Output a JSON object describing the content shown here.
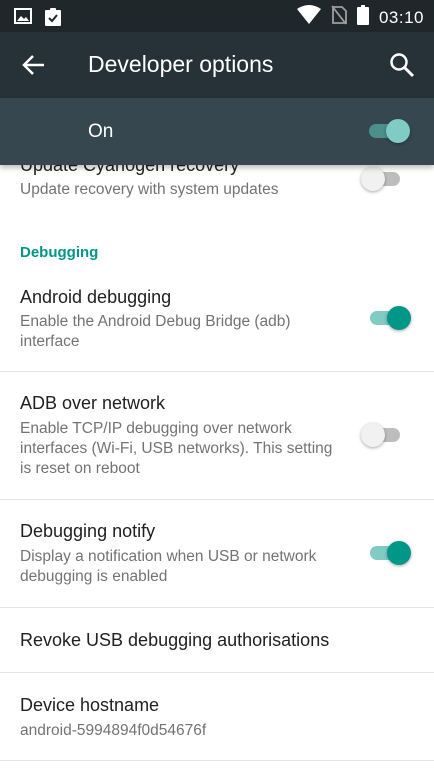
{
  "status_bar": {
    "time": "03:10",
    "icons": [
      "gallery-icon",
      "clipboard-check-icon",
      "wifi-icon",
      "no-sim-icon",
      "battery-icon"
    ]
  },
  "app_bar": {
    "title": "Developer options",
    "back_icon": "back-arrow-icon",
    "search_icon": "search-icon"
  },
  "master_switch": {
    "label": "On",
    "state": "on"
  },
  "list": {
    "partial_item": {
      "title": "Update Cyanogen recovery",
      "summary": "Update recovery with system updates",
      "toggle": "off"
    },
    "category": "Debugging",
    "items": [
      {
        "title": "Android debugging",
        "summary": "Enable the Android Debug Bridge (adb) interface",
        "toggle": "on"
      },
      {
        "title": "ADB over network",
        "summary": "Enable TCP/IP debugging over network interfaces (Wi-Fi, USB networks). This setting is reset on reboot",
        "toggle": "off"
      },
      {
        "title": "Debugging notify",
        "summary": "Display a notification when USB or network debugging is enabled",
        "toggle": "on"
      },
      {
        "title": "Revoke USB debugging authorisations"
      },
      {
        "title": "Device hostname",
        "summary": "android-5994894f0d54676f"
      }
    ]
  },
  "colors": {
    "status_bar": "#1f272b",
    "app_bar": "#263238",
    "master_bar": "#37474f",
    "accent": "#009688",
    "accent_light": "#80cbc4"
  }
}
